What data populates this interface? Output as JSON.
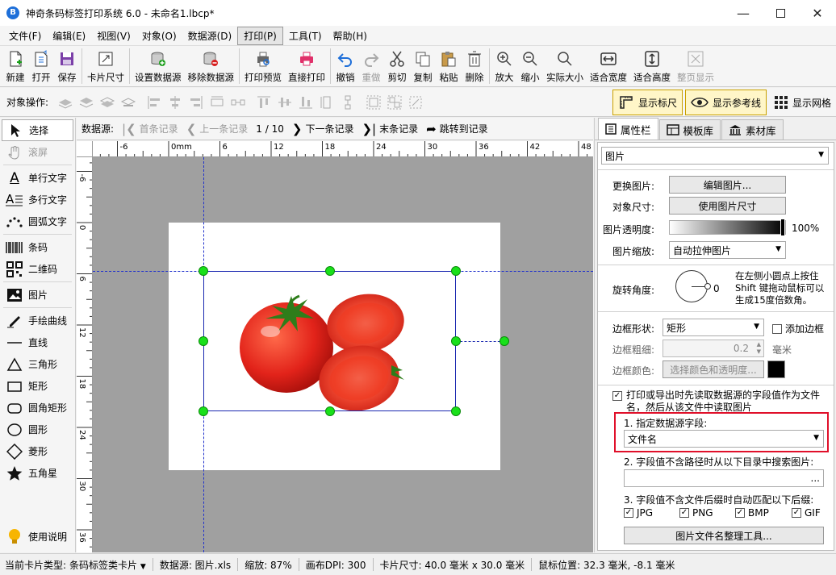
{
  "window": {
    "title": "神奇条码标签打印系统 6.0 - 未命名1.lbcp*",
    "app_icon_letter": "B"
  },
  "menu": [
    "文件(F)",
    "编辑(E)",
    "视图(V)",
    "对象(O)",
    "数据源(D)",
    "打印(P)",
    "工具(T)",
    "帮助(H)"
  ],
  "toolbar": {
    "new": "新建",
    "open": "打开",
    "save": "保存",
    "card_size": "卡片尺寸",
    "set_datasource": "设置数据源",
    "remove_datasource": "移除数据源",
    "print_preview": "打印预览",
    "direct_print": "直接打印",
    "undo": "撤销",
    "redo": "重做",
    "cut": "剪切",
    "copy": "复制",
    "paste": "粘贴",
    "delete": "删除",
    "zoom_in": "放大",
    "zoom_out": "缩小",
    "actual_size": "实际大小",
    "fit_width": "适合宽度",
    "fit_height": "适合高度",
    "full_page": "整页显示"
  },
  "objbar": {
    "label": "对象操作:",
    "show_ruler": "显示标尺",
    "show_guides": "显示参考线",
    "show_grid": "显示网格"
  },
  "tools": {
    "select": "选择",
    "scroll": "滚屏",
    "single_text": "单行文字",
    "multi_text": "多行文字",
    "arc_text": "圆弧文字",
    "barcode": "条码",
    "qrcode": "二维码",
    "image": "图片",
    "freehand": "手绘曲线",
    "line": "直线",
    "triangle": "三角形",
    "rect": "矩形",
    "round_rect": "圆角矩形",
    "circle": "圆形",
    "diamond": "菱形",
    "star": "五角星",
    "help": "使用说明"
  },
  "nav": {
    "label": "数据源:",
    "first": "首条记录",
    "prev": "上一条记录",
    "counter": "1 / 10",
    "next": "下一条记录",
    "last": "末条记录",
    "jump": "跳转到记录"
  },
  "ruler": {
    "h_ticks": [
      "-6",
      "0mm",
      "6",
      "12",
      "18",
      "24",
      "30",
      "36",
      "42",
      "48"
    ],
    "v_ticks": [
      "-6",
      "0",
      "6",
      "12",
      "18",
      "24",
      "30",
      "36"
    ]
  },
  "panel": {
    "tabs": [
      "属性栏",
      "模板库",
      "素材库"
    ],
    "object_type": "图片",
    "change_image_label": "更换图片:",
    "edit_image_btn": "编辑图片...",
    "object_size_label": "对象尺寸:",
    "use_image_size_btn": "使用图片尺寸",
    "opacity_label": "图片透明度:",
    "opacity_value": "100%",
    "scale_label": "图片缩放:",
    "scale_value": "自动拉伸图片",
    "rotate_label": "旋转角度:",
    "rotate_value": "0",
    "rotate_hint": "在左侧小圆点上按住 Shift 键拖动鼠标可以生成15度倍数角。",
    "border_shape_label": "边框形状:",
    "border_shape_value": "矩形",
    "add_border": "添加边框",
    "border_width_label": "边框粗细:",
    "border_width_value": "0.2",
    "border_width_unit": "毫米",
    "border_color_label": "边框颜色:",
    "border_color_btn": "选择颜色和透明度...",
    "read_from_ds": "打印或导出时先读取数据源的字段值作为文件名，然后从该文件中读取图片",
    "step1": "1. 指定数据源字段:",
    "field_value": "文件名",
    "step2": "2. 字段值不含路径时从以下目录中搜索图片:",
    "dir_value": "",
    "step3": "3. 字段值不含文件后缀时自动匹配以下后缀:",
    "ext": [
      "JPG",
      "PNG",
      "BMP",
      "GIF"
    ],
    "organize_btn": "图片文件名整理工具..."
  },
  "status": {
    "card_type": "当前卡片类型:",
    "card_type_value": "条码标签类卡片",
    "datasource": "数据源: 图片.xls",
    "zoom": "缩放: 87%",
    "dpi": "画布DPI: 300",
    "card_size": "卡片尺寸: 40.0 毫米 x 30.0 毫米",
    "mouse": "鼠标位置: 32.3 毫米, -8.1 毫米"
  },
  "colors": {
    "accent_red": "#e0102a",
    "guide_blue": "#2233cc",
    "handle_green": "#19e01a",
    "highlight_yellow": "#fff6c8"
  }
}
